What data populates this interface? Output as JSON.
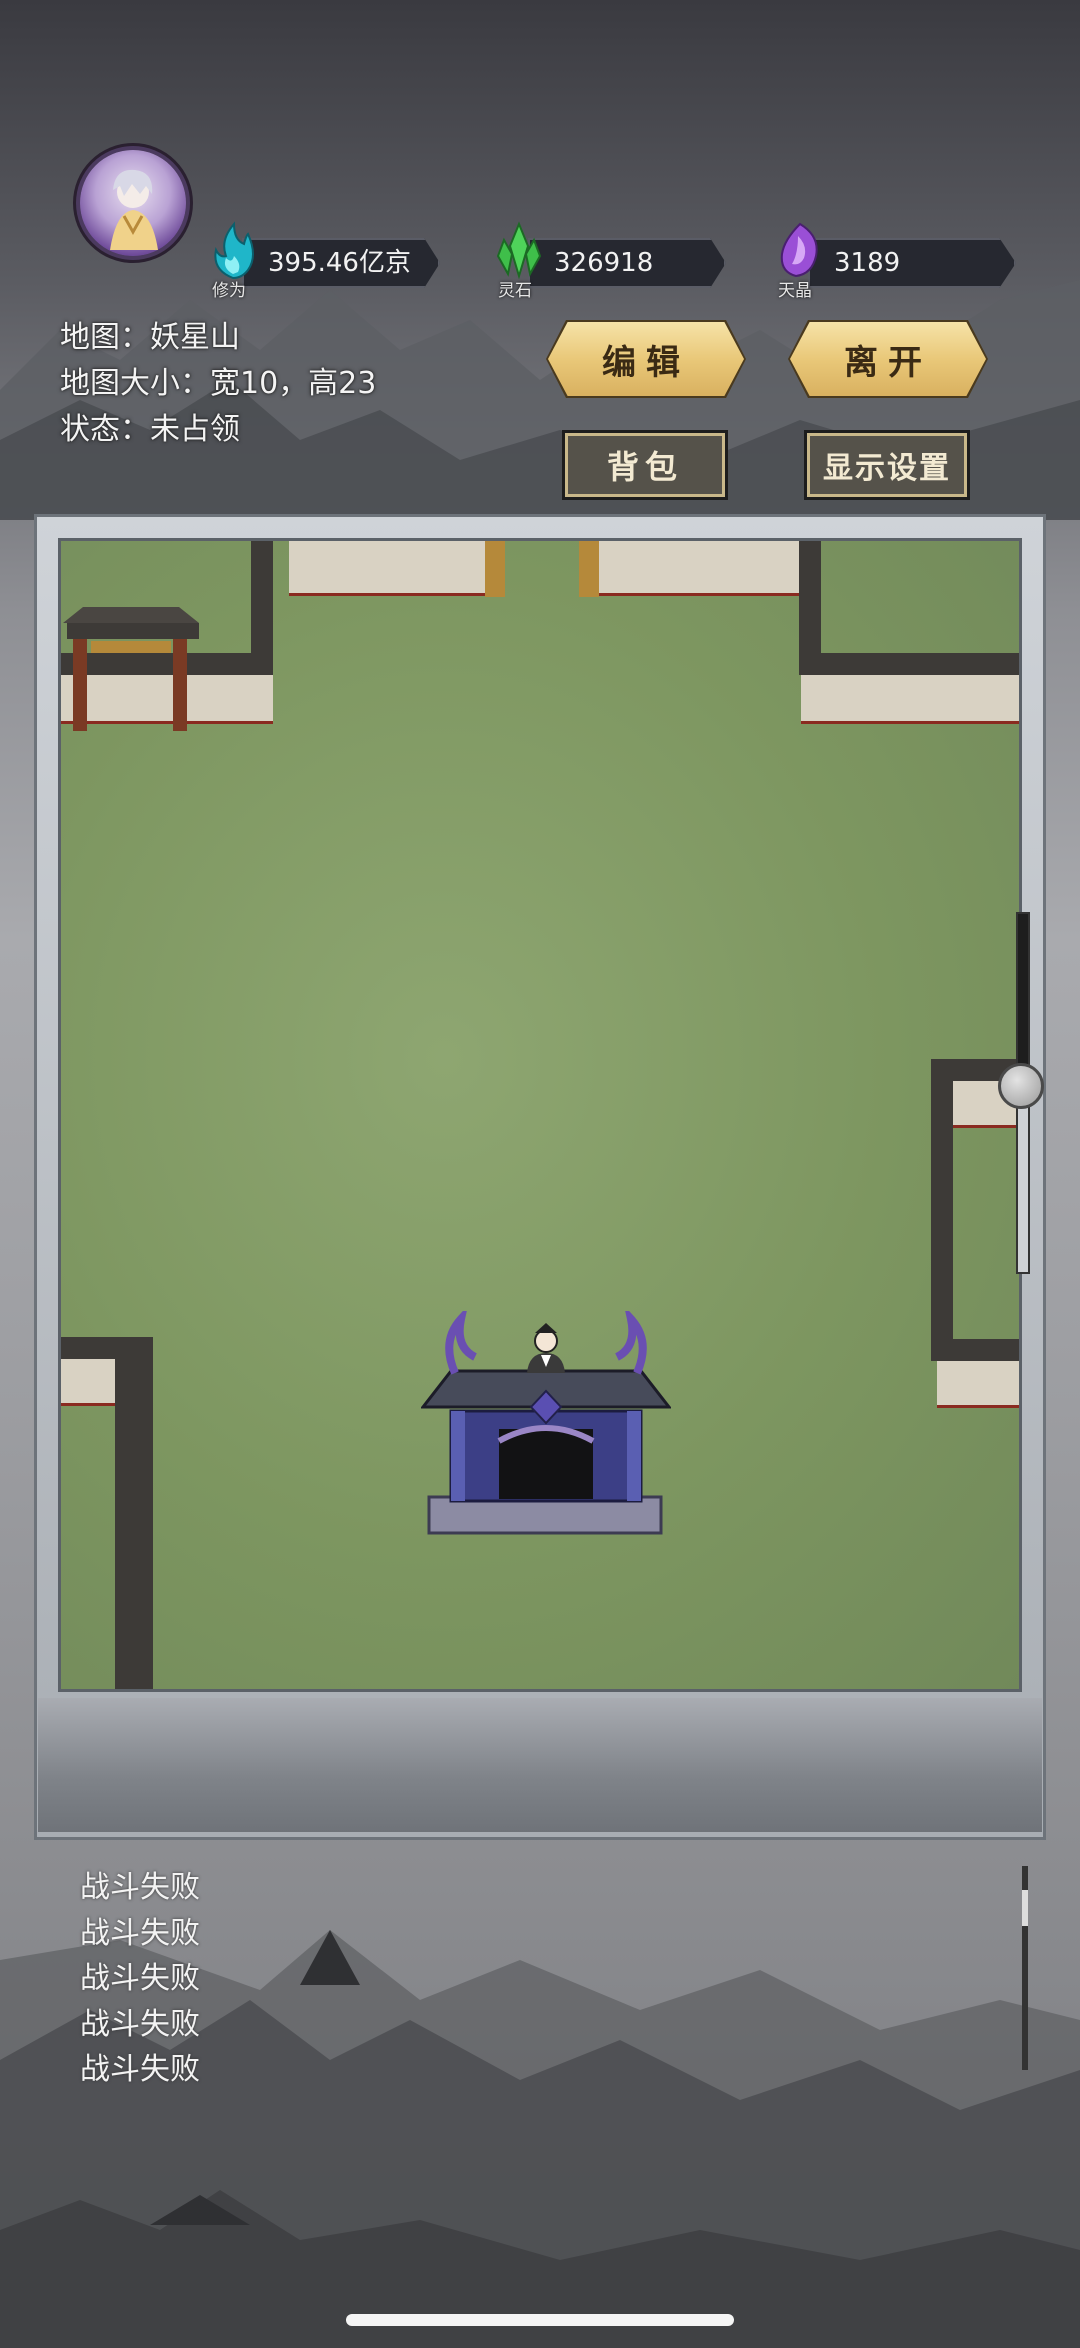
{
  "resources": [
    {
      "icon": "cultivation-flame-icon",
      "label": "修为",
      "value": "395.46亿京",
      "color": "#1fb6c9"
    },
    {
      "icon": "spirit-stone-icon",
      "label": "灵石",
      "value": "326918",
      "color": "#3fbf4a"
    },
    {
      "icon": "sky-crystal-icon",
      "label": "天晶",
      "value": "3189",
      "color": "#9a4fd6"
    }
  ],
  "map_info": {
    "name_line": "地图：妖星山",
    "size_line": "地图大小：宽10，高23",
    "status_line": "状态：未占领"
  },
  "buttons": {
    "edit": "编辑",
    "leave": "离开",
    "backpack": "背包",
    "display_settings": "显示设置"
  },
  "zoom_slider": {
    "level": 0.52
  },
  "battle_log": [
    "战斗失败",
    "战斗失败",
    "战斗失败",
    "战斗失败",
    "战斗失败"
  ]
}
